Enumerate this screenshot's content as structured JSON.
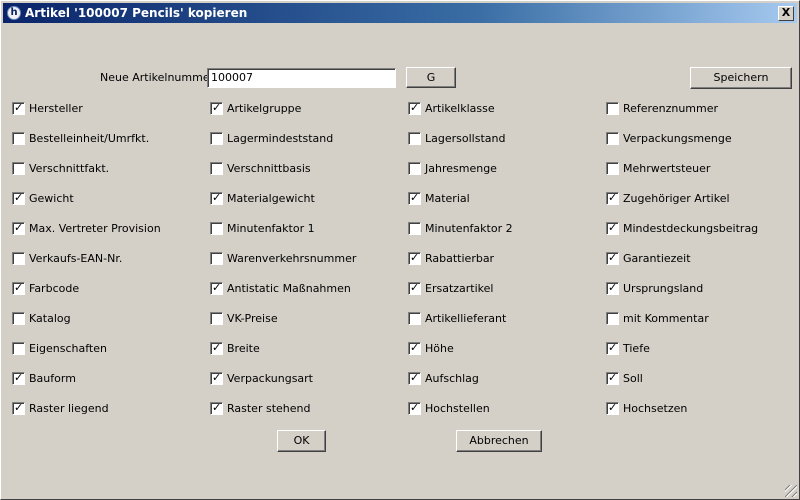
{
  "window": {
    "title": "Artikel '100007 Pencils' kopieren",
    "close_label": "X",
    "app_icon_glyph": "h"
  },
  "form": {
    "new_article_label": "Neue Artikelnummer",
    "new_article_value": "100007",
    "g_button": "G",
    "save_button": "Speichern",
    "ok_button": "OK",
    "cancel_button": "Abbrechen"
  },
  "checkboxes": [
    [
      {
        "label": "Hersteller",
        "checked": true
      },
      {
        "label": "Bestelleinheit/Umrfkt.",
        "checked": false
      },
      {
        "label": "Verschnittfakt.",
        "checked": false
      },
      {
        "label": "Gewicht",
        "checked": true
      },
      {
        "label": "Max. Vertreter Provision",
        "checked": true
      },
      {
        "label": "Verkaufs-EAN-Nr.",
        "checked": false
      },
      {
        "label": "Farbcode",
        "checked": true
      },
      {
        "label": "Katalog",
        "checked": false
      },
      {
        "label": "Eigenschaften",
        "checked": false
      },
      {
        "label": "Bauform",
        "checked": true
      },
      {
        "label": "Raster liegend",
        "checked": true
      }
    ],
    [
      {
        "label": "Artikelgruppe",
        "checked": true
      },
      {
        "label": "Lagermindeststand",
        "checked": false
      },
      {
        "label": "Verschnittbasis",
        "checked": false
      },
      {
        "label": "Materialgewicht",
        "checked": true
      },
      {
        "label": "Minutenfaktor 1",
        "checked": false
      },
      {
        "label": "Warenverkehrsnummer",
        "checked": false
      },
      {
        "label": "Antistatic Maßnahmen",
        "checked": true
      },
      {
        "label": "VK-Preise",
        "checked": false
      },
      {
        "label": "Breite",
        "checked": true
      },
      {
        "label": "Verpackungsart",
        "checked": true
      },
      {
        "label": "Raster stehend",
        "checked": true
      }
    ],
    [
      {
        "label": "Artikelklasse",
        "checked": true
      },
      {
        "label": "Lagersollstand",
        "checked": false
      },
      {
        "label": "Jahresmenge",
        "checked": false
      },
      {
        "label": "Material",
        "checked": true
      },
      {
        "label": "Minutenfaktor 2",
        "checked": false
      },
      {
        "label": "Rabattierbar",
        "checked": true
      },
      {
        "label": "Ersatzartikel",
        "checked": true
      },
      {
        "label": "Artikellieferant",
        "checked": false
      },
      {
        "label": "Höhe",
        "checked": true
      },
      {
        "label": "Aufschlag",
        "checked": true
      },
      {
        "label": "Hochstellen",
        "checked": true
      }
    ],
    [
      {
        "label": "Referenznummer",
        "checked": false
      },
      {
        "label": "Verpackungsmenge",
        "checked": false
      },
      {
        "label": "Mehrwertsteuer",
        "checked": false
      },
      {
        "label": "Zugehöriger Artikel",
        "checked": true
      },
      {
        "label": "Mindestdeckungsbeitrag",
        "checked": true
      },
      {
        "label": "Garantiezeit",
        "checked": true
      },
      {
        "label": "Ursprungsland",
        "checked": true
      },
      {
        "label": "mit Kommentar",
        "checked": false
      },
      {
        "label": "Tiefe",
        "checked": true
      },
      {
        "label": "Soll",
        "checked": true
      },
      {
        "label": "Hochsetzen",
        "checked": true
      }
    ]
  ]
}
